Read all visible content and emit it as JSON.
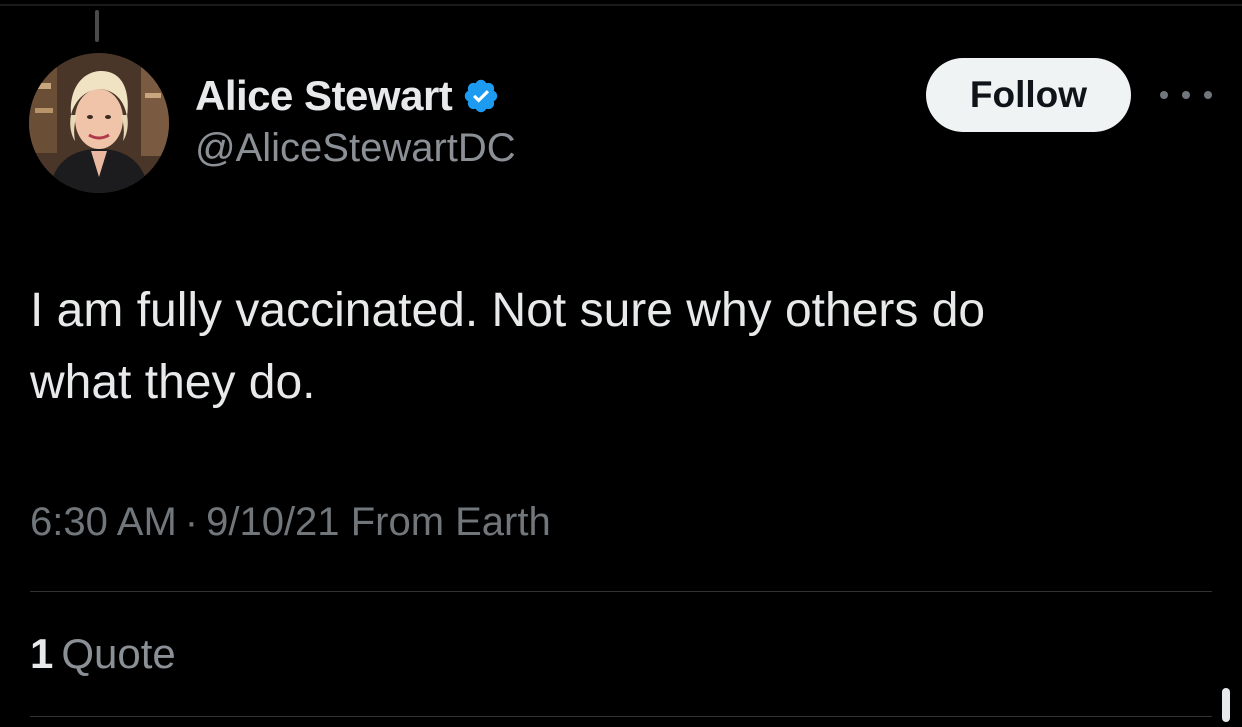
{
  "tweet": {
    "author": {
      "display_name": "Alice Stewart",
      "handle": "@AliceStewartDC",
      "verified": true,
      "verified_color": "#1d9bf0",
      "avatar_icon": "profile-photo"
    },
    "follow_label": "Follow",
    "more_icon": "ellipsis-icon",
    "text_lines": [
      "I am fully vaccinated. Not sure why others do",
      "what they do."
    ],
    "meta": {
      "time": "6:30 AM",
      "separator": "·",
      "date": "9/10/21",
      "source": "From Earth"
    },
    "quotes": {
      "count": "1",
      "label": "Quote"
    }
  },
  "colors": {
    "background": "#000000",
    "primary_text": "#e7e9ea",
    "secondary_text": "#71767b",
    "divider": "#2f3336",
    "follow_bg": "#eff3f4",
    "follow_text": "#0f1419"
  }
}
